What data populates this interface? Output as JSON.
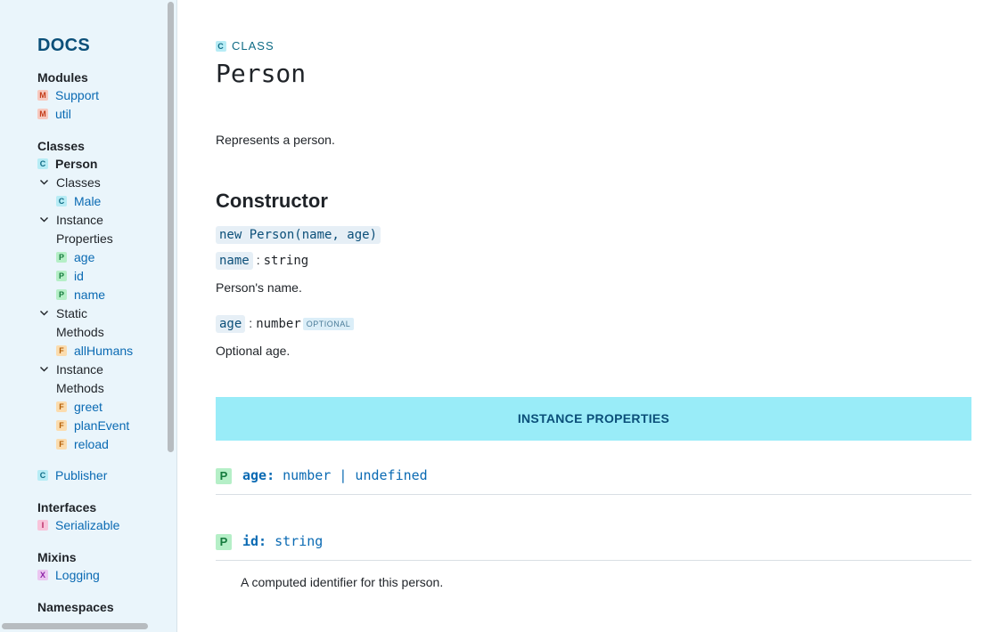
{
  "sidebar": {
    "brand": "DOCS",
    "sections": {
      "modules": "Modules",
      "classes": "Classes",
      "interfaces": "Interfaces",
      "mixins": "Mixins",
      "namespaces": "Namespaces"
    },
    "modules": [
      {
        "badge": "M",
        "label": "Support"
      },
      {
        "badge": "M",
        "label": "util"
      }
    ],
    "classes": {
      "person": {
        "badge": "C",
        "label": "Person"
      },
      "groups": {
        "classes": "Classes",
        "instance_properties_1": "Instance",
        "instance_properties_2": "Properties",
        "static_methods_1": "Static",
        "static_methods_2": "Methods",
        "instance_methods_1": "Instance",
        "instance_methods_2": "Methods"
      },
      "male": {
        "badge": "C",
        "label": "Male"
      },
      "properties": [
        {
          "badge": "P",
          "label": "age"
        },
        {
          "badge": "P",
          "label": "id"
        },
        {
          "badge": "P",
          "label": "name"
        }
      ],
      "static_methods": [
        {
          "badge": "F",
          "label": "allHumans"
        }
      ],
      "instance_methods": [
        {
          "badge": "F",
          "label": "greet"
        },
        {
          "badge": "F",
          "label": "planEvent"
        },
        {
          "badge": "F",
          "label": "reload"
        }
      ],
      "publisher": {
        "badge": "C",
        "label": "Publisher"
      }
    },
    "interfaces": [
      {
        "badge": "I",
        "label": "Serializable"
      }
    ],
    "mixins": [
      {
        "badge": "X",
        "label": "Logging"
      }
    ]
  },
  "main": {
    "kind_badge": "C",
    "kind": "CLASS",
    "title": "Person",
    "description": "Represents a person.",
    "constructor_heading": "Constructor",
    "signature": "new Person(name, age)",
    "params": [
      {
        "name": "name",
        "colon": ":",
        "type": "string",
        "desc": "Person's name."
      },
      {
        "name": "age",
        "colon": ":",
        "type": "number",
        "optional": "OPTIONAL",
        "desc": "Optional age."
      }
    ],
    "banner": "INSTANCE PROPERTIES",
    "properties": [
      {
        "badge": "P",
        "name": "age:",
        "type": "number | undefined"
      },
      {
        "badge": "P",
        "name": "id:",
        "type": "string",
        "desc": "A computed identifier for this person."
      }
    ]
  },
  "colors": {
    "sidebar_bg": "#eaf5fb",
    "link": "#0a6ab3",
    "brand": "#0b4f79",
    "banner_bg": "#99ecf8"
  }
}
